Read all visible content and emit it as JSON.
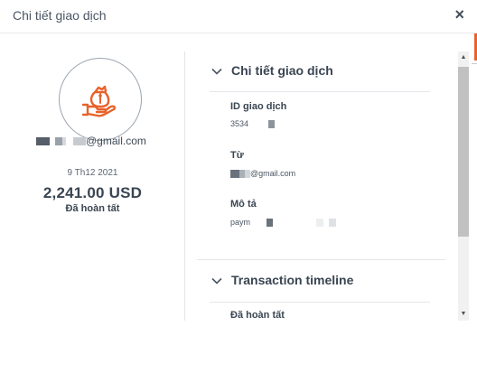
{
  "dialog": {
    "title": "Chi tiết giao dịch",
    "close_glyph": "×"
  },
  "summary": {
    "email_suffix": "@gmail.com",
    "date": "9 Th12 2021",
    "amount": "2,241.00 USD",
    "status": "Đã hoàn tất"
  },
  "details": {
    "heading": "Chi tiết giao dịch",
    "id_label": "ID giao dịch",
    "id_value_prefix": "3534",
    "from_label": "Từ",
    "from_value_suffix": "@gmail.com",
    "desc_label": "Mô tả",
    "desc_value_prefix": "paym"
  },
  "timeline": {
    "heading": "Transaction timeline",
    "first_status": "Đã hoàn tất"
  },
  "colors": {
    "accent": "#e8622a",
    "text": "#3a4552",
    "divider": "#e3e6ea"
  },
  "icons": {
    "avatar_icon": "hand-money-bag-icon",
    "section_toggle": "chevron-down-icon"
  }
}
